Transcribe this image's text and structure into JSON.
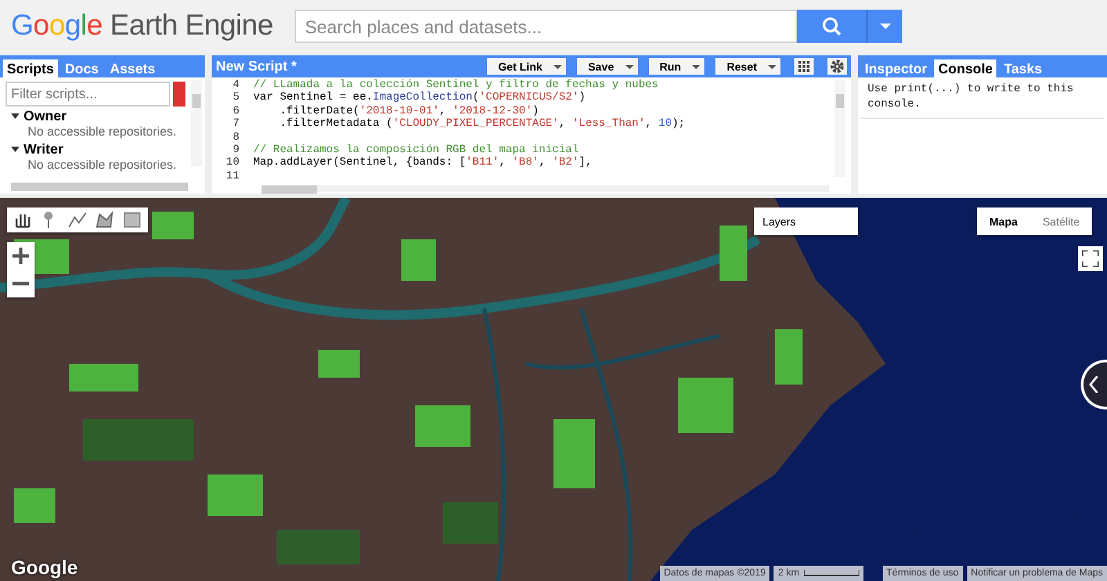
{
  "header": {
    "logo": {
      "brand": "Google",
      "product": "Earth Engine"
    },
    "search": {
      "placeholder": "Search places and datasets..."
    }
  },
  "scripts_panel": {
    "tabs": [
      {
        "label": "Scripts",
        "selected": true
      },
      {
        "label": "Docs",
        "selected": false
      },
      {
        "label": "Assets",
        "selected": false
      }
    ],
    "filter": {
      "placeholder": "Filter scripts..."
    },
    "tree": [
      {
        "label": "Owner",
        "expanded": true,
        "children": [
          {
            "label": "No accessible repositories."
          }
        ]
      },
      {
        "label": "Writer",
        "expanded": true,
        "children": [
          {
            "label": "No accessible repositories."
          }
        ]
      }
    ]
  },
  "editor": {
    "title": "New Script *",
    "buttons": [
      {
        "label": "Get Link"
      },
      {
        "label": "Save"
      },
      {
        "label": "Run"
      },
      {
        "label": "Reset"
      }
    ],
    "lines": [
      {
        "number": "4",
        "tokens": [
          {
            "kind": "comment",
            "text": "// LLamada a la colección Sentinel y filtro de fechas y nubes"
          }
        ]
      },
      {
        "number": "5",
        "tokens": [
          {
            "kind": "plain",
            "text": "var Sentinel = ee."
          },
          {
            "kind": "method",
            "text": "ImageCollection"
          },
          {
            "kind": "plain",
            "text": "("
          },
          {
            "kind": "string",
            "text": "'COPERNICUS/S2'"
          },
          {
            "kind": "plain",
            "text": ")"
          }
        ]
      },
      {
        "number": "6",
        "tokens": [
          {
            "kind": "plain",
            "text": "    .filterDate("
          },
          {
            "kind": "string",
            "text": "'2018-10-01'"
          },
          {
            "kind": "plain",
            "text": ", "
          },
          {
            "kind": "string",
            "text": "'2018-12-30'"
          },
          {
            "kind": "plain",
            "text": ")"
          }
        ]
      },
      {
        "number": "7",
        "tokens": [
          {
            "kind": "plain",
            "text": "    .filterMetadata ("
          },
          {
            "kind": "string",
            "text": "'CLOUDY_PIXEL_PERCENTAGE'"
          },
          {
            "kind": "plain",
            "text": ", "
          },
          {
            "kind": "string",
            "text": "'Less_Than'"
          },
          {
            "kind": "plain",
            "text": ", "
          },
          {
            "kind": "number",
            "text": "10"
          },
          {
            "kind": "plain",
            "text": ");"
          }
        ]
      },
      {
        "number": "8"
      },
      {
        "number": "9",
        "tokens": [
          {
            "kind": "comment",
            "text": "// Realizamos la composición RGB del mapa inicial"
          }
        ]
      },
      {
        "number": "10",
        "tokens": [
          {
            "kind": "plain",
            "text": "Map.addLayer(Sentinel, {bands: ["
          },
          {
            "kind": "string",
            "text": "'B11'"
          },
          {
            "kind": "plain",
            "text": ", "
          },
          {
            "kind": "string",
            "text": "'B8'"
          },
          {
            "kind": "plain",
            "text": ", "
          },
          {
            "kind": "string",
            "text": "'B2'"
          },
          {
            "kind": "plain",
            "text": "],"
          }
        ]
      },
      {
        "number": "11"
      }
    ]
  },
  "console_panel": {
    "tabs": [
      {
        "label": "Inspector",
        "selected": false
      },
      {
        "label": "Console",
        "selected": true
      },
      {
        "label": "Tasks",
        "selected": false
      }
    ],
    "message": "Use print(...) to write to this console."
  },
  "map": {
    "layers_button": "Layers",
    "map_types": [
      {
        "label": "Mapa",
        "selected": true
      },
      {
        "label": "Satélite",
        "selected": false
      }
    ],
    "logo": "Google",
    "attribution": {
      "data": "Datos de mapas ©2019",
      "scale": "2 km",
      "terms": "Términos de uso",
      "report": "Notificar un problema de Maps"
    }
  }
}
